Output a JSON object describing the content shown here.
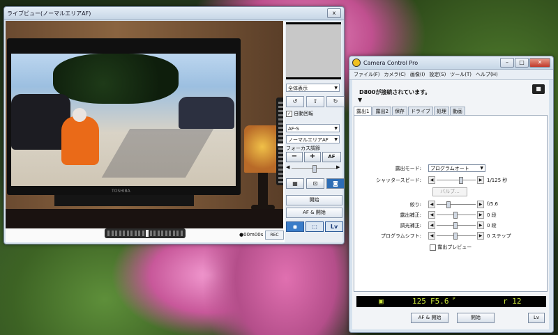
{
  "liveview": {
    "title": "ライブビュー(ノーマルエリアAF)",
    "close_label": "x",
    "tv_brand": "TOSHIBA",
    "timer": "00m00s",
    "rec_label": "REC",
    "display_mode": "全体表示",
    "auto_rotate_label": "自動回転",
    "af_mode": "AF-S",
    "af_area": "ノーマルエリアAF",
    "focus_adjust_label": "フォーカス調節",
    "minus_label": "−",
    "plus_label": "+",
    "af_label": "AF",
    "start_label": "開始",
    "af_start_label": "AF & 開始",
    "lv_label": "Lv"
  },
  "ccp": {
    "title": "Camera Control Pro",
    "menu": [
      "ファイル(F)",
      "カメラ(C)",
      "画像(I)",
      "設定(S)",
      "ツール(T)",
      "ヘルプ(H)"
    ],
    "status": "D800が接続されています。",
    "tabs": [
      "露出1",
      "露出2",
      "保存",
      "ドライブ",
      "処理",
      "動画"
    ],
    "active_tab": 0,
    "exposure_mode_label": "露出モード:",
    "exposure_mode_value": "プログラムオート",
    "shutter_label": "シャッタースピード:",
    "shutter_value": "1/125 秒",
    "bulb_label": "バルブ...",
    "aperture_label": "絞り:",
    "aperture_value": "f/5.6",
    "exp_comp_label": "露出補正:",
    "exp_comp_value": "0 段",
    "flash_comp_label": "調光補正:",
    "flash_comp_value": "0 段",
    "program_shift_label": "プログラムシフト:",
    "program_shift_value": "0 ステップ",
    "exposure_preview_label": "露出プレビュー",
    "lcd_shutter": "125",
    "lcd_aperture": "F5.6",
    "lcd_mode": "P",
    "lcd_frames": "r 12",
    "af_start_label": "AF & 開始",
    "start_label": "開始",
    "lv_label": "Lv"
  },
  "colors": {
    "accent_blue": "#3a7cc8",
    "lcd_green": "#c8e23a"
  }
}
